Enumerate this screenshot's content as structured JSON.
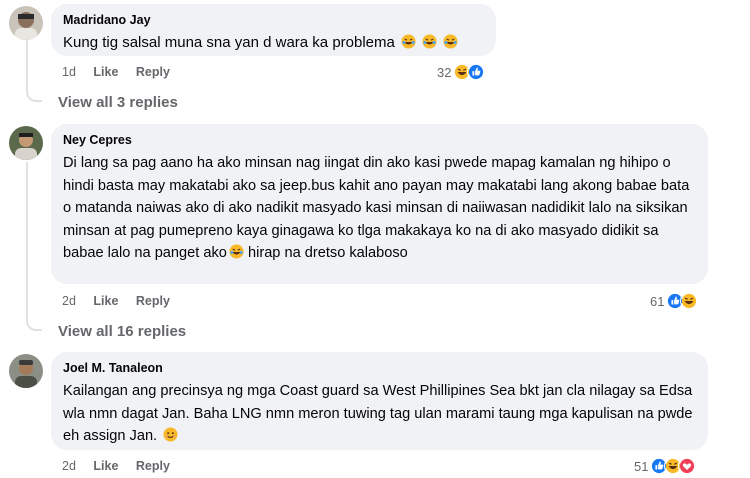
{
  "comments": [
    {
      "author": "Madridano Jay",
      "text": "Kung tig salsal muna sna yan d wara ka problema",
      "time": "1d",
      "like_label": "Like",
      "reply_label": "Reply",
      "reaction_count": "32",
      "reactions": [
        "haha",
        "like"
      ],
      "view_replies": "View all 3 replies"
    },
    {
      "author": "Ney Cepres",
      "text": "Di lang sa pag aano ha ako minsan nag iingat din ako kasi pwede mapag kamalan ng hihipo o hindi basta may makatabi ako sa jeep.bus kahit ano payan may makatabi lang akong babae bata o matanda naiwas ako di ako nadikit masyado kasi minsan di naiiwasan nadidikit lalo na siksikan minsan at pag pumepreno kaya ginagawa ko tlga makakaya ko na di ako masyado didikit sa babae lalo na panget ako",
      "text_after_emoji": " hirap na dretso kalaboso",
      "time": "2d",
      "like_label": "Like",
      "reply_label": "Reply",
      "reaction_count": "61",
      "reactions": [
        "like",
        "haha"
      ],
      "view_replies": "View all 16 replies"
    },
    {
      "author": "Joel M. Tanaleon",
      "text": "Kailangan ang precinsya ng mga Coast guard sa West Phillipines Sea bkt jan cla nilagay sa Edsa wla nmn dagat Jan. Baha LNG nmn meron tuwing tag ulan marami taung mga kapulisan na pwde eh assign Jan.",
      "time": "2d",
      "like_label": "Like",
      "reply_label": "Reply",
      "reaction_count": "51",
      "reactions": [
        "like",
        "haha",
        "love"
      ]
    }
  ],
  "colors": {
    "bubble": "#f0f2f5",
    "meta": "#65676b",
    "like_blue": "#1877f2",
    "haha_yellow": "#f7b928",
    "love_red": "#f33e58"
  }
}
